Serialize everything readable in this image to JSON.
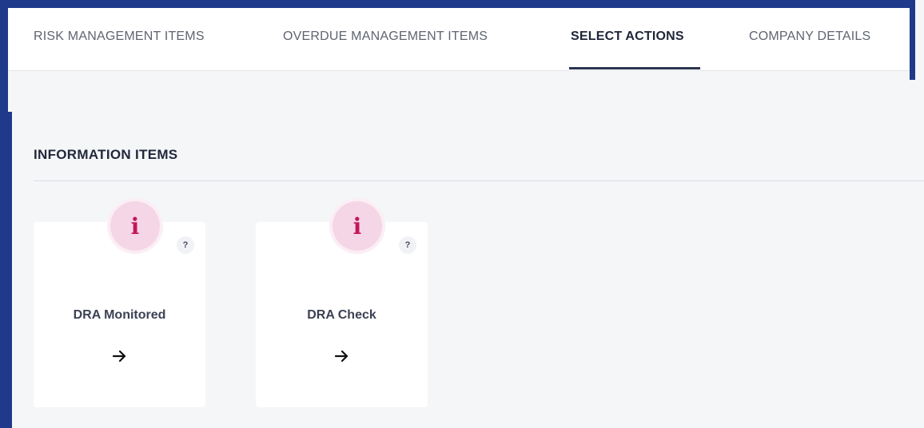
{
  "tabs": [
    {
      "label": "RISK MANAGEMENT ITEMS",
      "active": false
    },
    {
      "label": "OVERDUE MANAGEMENT ITEMS",
      "active": false
    },
    {
      "label": "SELECT ACTIONS",
      "active": true
    },
    {
      "label": "COMPANY DETAILS",
      "active": false
    }
  ],
  "section": {
    "title": "INFORMATION ITEMS"
  },
  "cards": [
    {
      "icon": "info-icon",
      "icon_glyph": "i",
      "help": "?",
      "label": "DRA Monitored",
      "arrow": "arrow-right-icon"
    },
    {
      "icon": "info-icon",
      "icon_glyph": "i",
      "help": "?",
      "label": "DRA Check",
      "arrow": "arrow-right-icon"
    }
  ],
  "colors": {
    "frame": "#1f3a8a",
    "accent": "#c2185b",
    "badge_bg": "#f5d6e6",
    "active_tab_underline": "#2b3550"
  }
}
